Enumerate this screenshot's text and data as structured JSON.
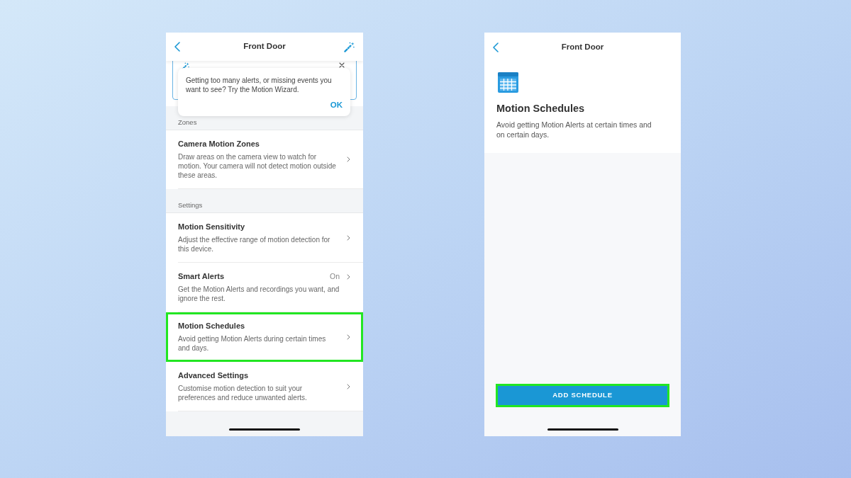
{
  "screens": [
    {
      "kind": "settings-list",
      "header": {
        "title": "Front Door"
      },
      "popup": {
        "message": "Getting too many alerts, or missing events you want to see? Try the Motion Wizard.",
        "button": "OK"
      },
      "sections": [
        {
          "title": "Zones",
          "rows": [
            {
              "title": "Camera Motion Zones",
              "description": "Draw areas on the camera view to watch for motion. Your camera will not detect motion outside these areas.",
              "highlighted": false
            }
          ]
        },
        {
          "title": "Settings",
          "rows": [
            {
              "title": "Motion Sensitivity",
              "description": "Adjust the effective range of motion detection for this device.",
              "highlighted": false
            },
            {
              "title": "Smart Alerts",
              "value": "On",
              "description": "Get the Motion Alerts and recordings you want, and ignore the rest.",
              "highlighted": false
            },
            {
              "title": "Motion Schedules",
              "description": "Avoid getting Motion Alerts during certain times and days.",
              "highlighted": true
            },
            {
              "title": "Advanced Settings",
              "description": "Customise motion detection to suit your preferences and reduce unwanted alerts.",
              "highlighted": false
            }
          ]
        }
      ]
    },
    {
      "kind": "detail",
      "header": {
        "title": "Front Door"
      },
      "title": "Motion Schedules",
      "description": "Avoid getting Motion Alerts at certain times and on certain days.",
      "button": {
        "label": "ADD SCHEDULE",
        "highlighted": true
      }
    }
  ]
}
